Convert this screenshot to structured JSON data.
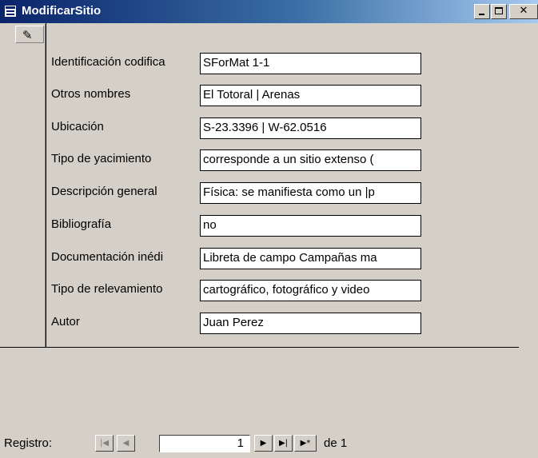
{
  "window": {
    "title": "ModificarSitio",
    "icon": "form-icon",
    "buttons": {
      "minimize": "_",
      "maximize": "□",
      "close": "✕"
    }
  },
  "record_selector": {
    "icon": "pencil-icon",
    "glyph": "✎"
  },
  "fields": [
    {
      "label": "Identificación codifica",
      "value": "SForMat 1-1"
    },
    {
      "label": "Otros nombres",
      "value": "El Totoral | Arenas"
    },
    {
      "label": "Ubicación",
      "value": " S-23.3396 | W-62.0516"
    },
    {
      "label": "Tipo de yacimiento",
      "value": "corresponde a un sitio extenso ("
    },
    {
      "label": "Descripción general",
      "value": "Física: se manifiesta como un |p"
    },
    {
      "label": "Bibliografía",
      "value": " no"
    },
    {
      "label": "Documentación inédi",
      "value": "Libreta de campo Campañas ma"
    },
    {
      "label": "Tipo de relevamiento",
      "value": "cartográfico, fotográfico y video"
    },
    {
      "label": "Autor",
      "value": "Juan Perez"
    }
  ],
  "navigation": {
    "label": "Registro:",
    "first": "|◀",
    "prev": "◀",
    "current": "1",
    "next": "▶",
    "last": "▶|",
    "new": "▶*",
    "of_text": "de  1"
  }
}
